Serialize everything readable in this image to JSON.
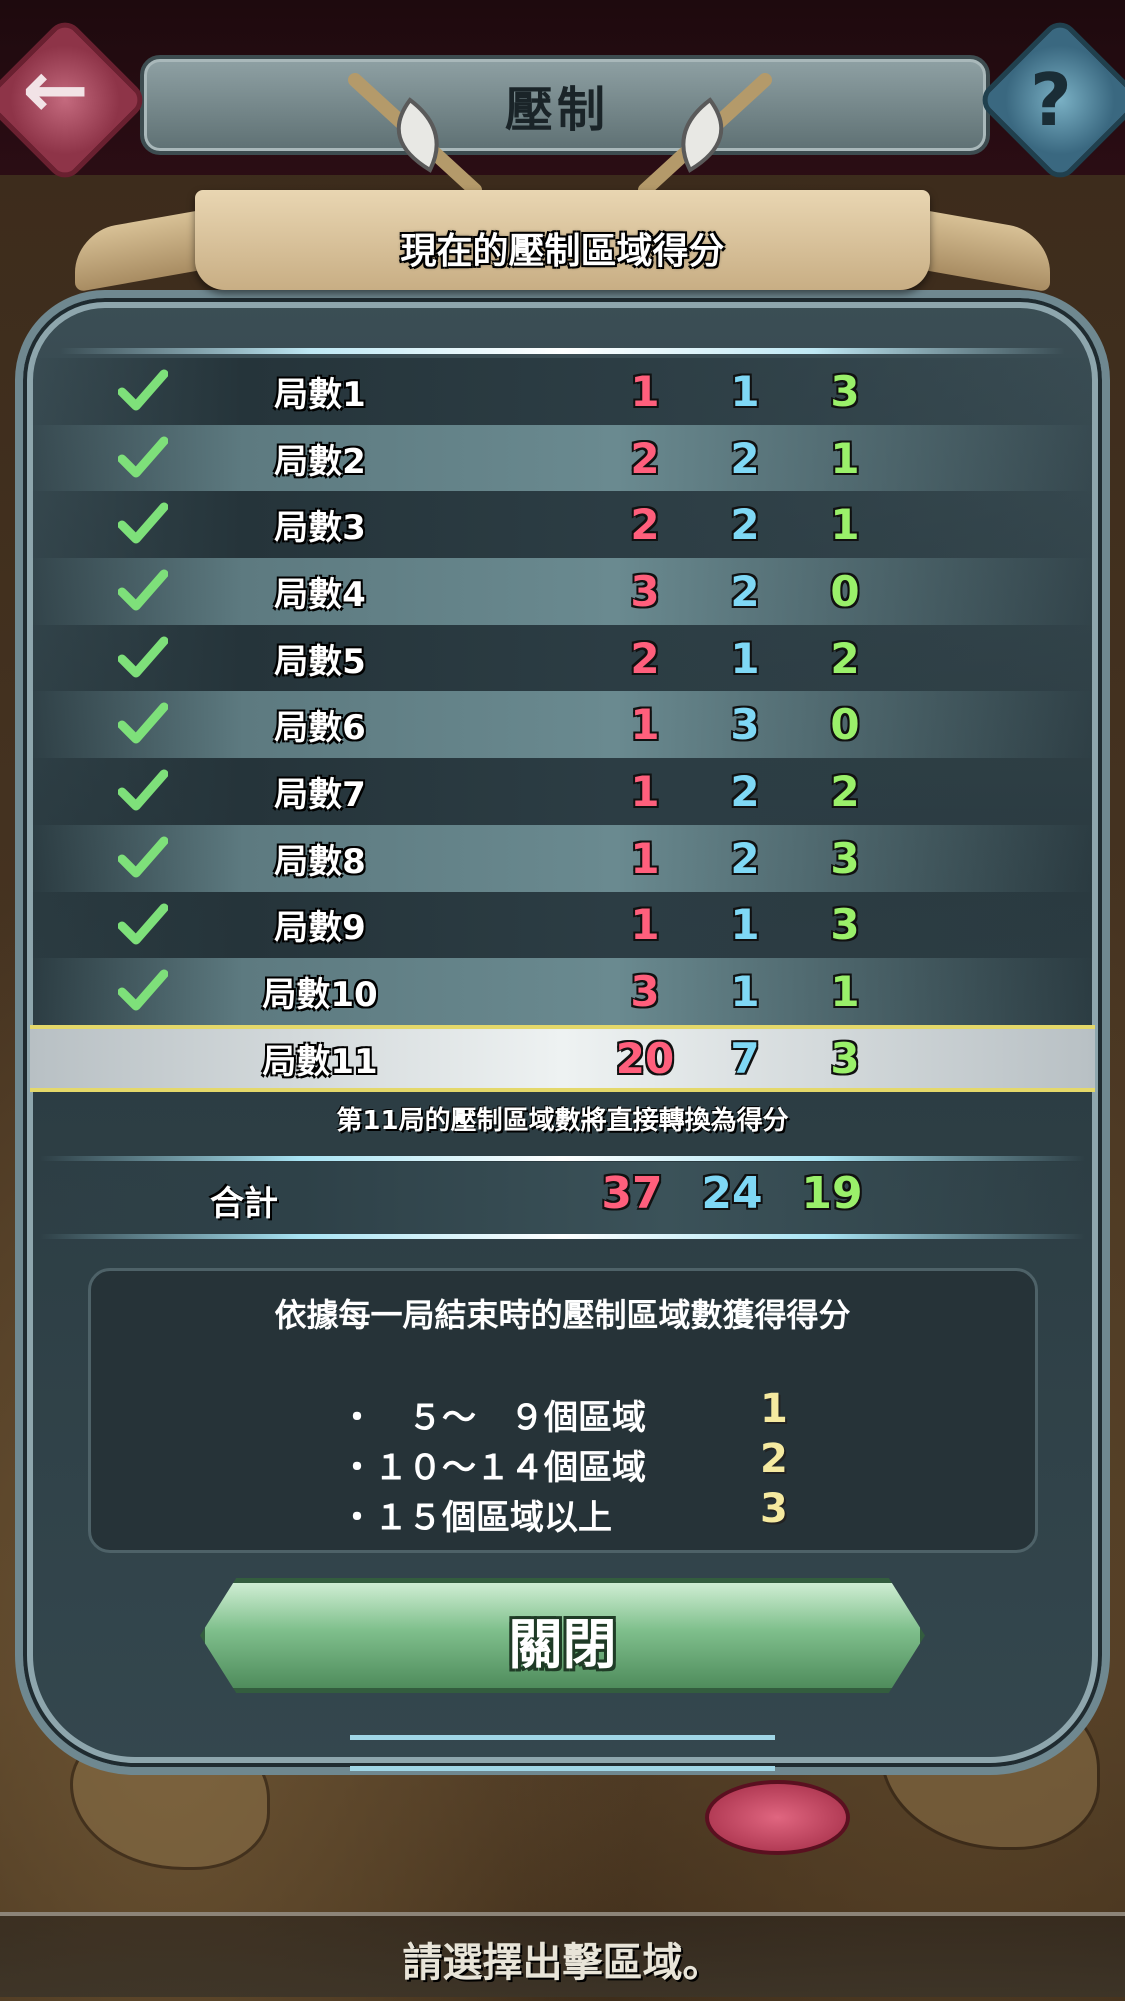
{
  "header": {
    "title": "壓制",
    "back_icon": "arrow-left-icon",
    "help_label": "?"
  },
  "banner": {
    "title": "現在的壓制區域得分"
  },
  "rounds": [
    {
      "label": "局數1",
      "completed": true,
      "red": "1",
      "blue": "1",
      "green": "3"
    },
    {
      "label": "局數2",
      "completed": true,
      "red": "2",
      "blue": "2",
      "green": "1"
    },
    {
      "label": "局數3",
      "completed": true,
      "red": "2",
      "blue": "2",
      "green": "1"
    },
    {
      "label": "局數4",
      "completed": true,
      "red": "3",
      "blue": "2",
      "green": "0"
    },
    {
      "label": "局數5",
      "completed": true,
      "red": "2",
      "blue": "1",
      "green": "2"
    },
    {
      "label": "局數6",
      "completed": true,
      "red": "1",
      "blue": "3",
      "green": "0"
    },
    {
      "label": "局數7",
      "completed": true,
      "red": "1",
      "blue": "2",
      "green": "2"
    },
    {
      "label": "局數8",
      "completed": true,
      "red": "1",
      "blue": "2",
      "green": "3"
    },
    {
      "label": "局數9",
      "completed": true,
      "red": "1",
      "blue": "1",
      "green": "3"
    },
    {
      "label": "局數10",
      "completed": true,
      "red": "3",
      "blue": "1",
      "green": "1"
    },
    {
      "label": "局數11",
      "completed": false,
      "red": "20",
      "blue": "7",
      "green": "3"
    }
  ],
  "note": "第11局的壓制區域數將直接轉換為得分",
  "total": {
    "label": "合計",
    "red": "37",
    "blue": "24",
    "green": "19"
  },
  "info": {
    "title": "依據每一局結束時的壓制區域數獲得得分",
    "tiers": [
      {
        "text": "・　５～　９個區域",
        "points": "1"
      },
      {
        "text": "・１０～１４個區域",
        "points": "2"
      },
      {
        "text": "・１５個區域以上",
        "points": "3"
      }
    ]
  },
  "close_label": "關閉",
  "bottom_prompt": "請選擇出擊區域。",
  "colors": {
    "red_team": "#ff5f7c",
    "blue_team": "#7fd8f5",
    "green_team": "#9af06a",
    "points": "#f5eaa0"
  }
}
